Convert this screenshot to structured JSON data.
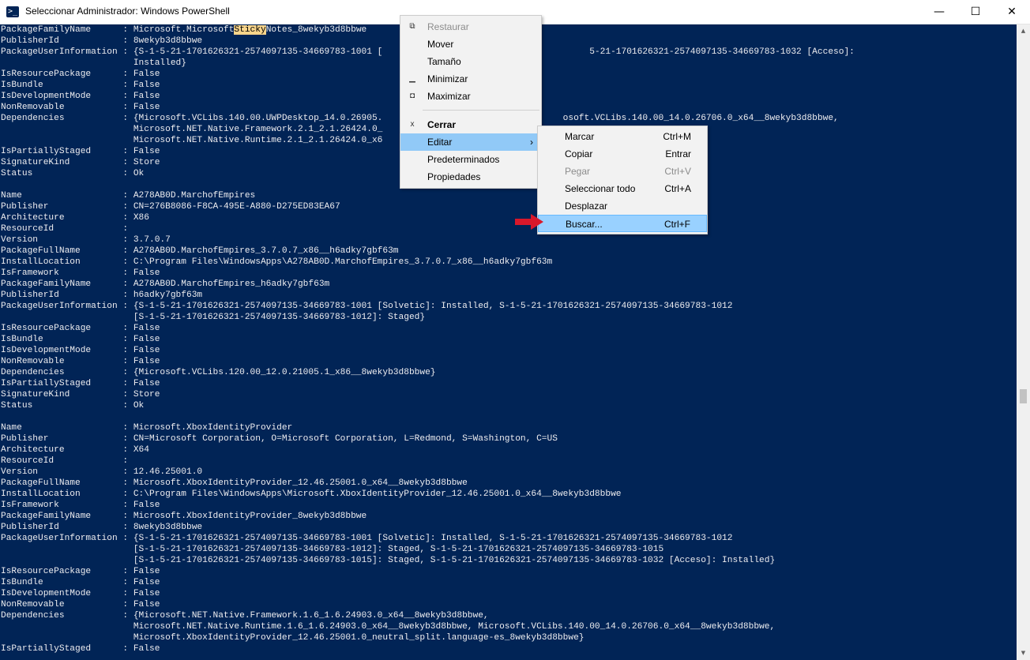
{
  "window": {
    "title": "Seleccionar Administrador: Windows PowerShell",
    "icon": "powershell-icon",
    "controls": {
      "minimize": "—",
      "maximize": "☐",
      "close": "✕"
    }
  },
  "colors": {
    "console_bg": "#012456",
    "console_text": "#eeedf0",
    "highlight": "#f9d58b",
    "menu_bg": "#f2f2f2",
    "menu_active": "#91c9f7",
    "arrow": "#d9182a"
  },
  "search_highlight": "Sticky",
  "console_lines": [
    [
      "PackageFamilyName      : Microsoft.Microsoft",
      "Sticky",
      "Notes_8wekyb3d8bbwe"
    ],
    [
      "PublisherId            : 8wekyb3d8bbwe"
    ],
    [
      "PackageUserInformation : {S-1-5-21-1701626321-2574097135-34669783-1001 [                                       5-21-1701626321-2574097135-34669783-1032 [Acceso]:"
    ],
    [
      "                         Installed}"
    ],
    [
      "IsResourcePackage      : False"
    ],
    [
      "IsBundle               : False"
    ],
    [
      "IsDevelopmentMode      : False"
    ],
    [
      "NonRemovable           : False"
    ],
    [
      "Dependencies           : {Microsoft.VCLibs.140.00.UWPDesktop_14.0.26905.                                  osoft.VCLibs.140.00_14.0.26706.0_x64__8wekyb3d8bbwe,"
    ],
    [
      "                         Microsoft.NET.Native.Framework.2.1_2.1.26424.0_"
    ],
    [
      "                         Microsoft.NET.Native.Runtime.2.1_2.1.26424.0_x6"
    ],
    [
      "IsPartiallyStaged      : False"
    ],
    [
      "SignatureKind          : Store"
    ],
    [
      "Status                 : Ok"
    ],
    [
      ""
    ],
    [
      "Name                   : A278AB0D.MarchofEmpires"
    ],
    [
      "Publisher              : CN=276B8086-F8CA-495E-A880-D275ED83EA67"
    ],
    [
      "Architecture           : X86"
    ],
    [
      "ResourceId             :"
    ],
    [
      "Version                : 3.7.0.7"
    ],
    [
      "PackageFullName        : A278AB0D.MarchofEmpires_3.7.0.7_x86__h6adky7gbf63m"
    ],
    [
      "InstallLocation        : C:\\Program Files\\WindowsApps\\A278AB0D.MarchofEmpires_3.7.0.7_x86__h6adky7gbf63m"
    ],
    [
      "IsFramework            : False"
    ],
    [
      "PackageFamilyName      : A278AB0D.MarchofEmpires_h6adky7gbf63m"
    ],
    [
      "PublisherId            : h6adky7gbf63m"
    ],
    [
      "PackageUserInformation : {S-1-5-21-1701626321-2574097135-34669783-1001 [Solvetic]: Installed, S-1-5-21-1701626321-2574097135-34669783-1012"
    ],
    [
      "                         [S-1-5-21-1701626321-2574097135-34669783-1012]: Staged}"
    ],
    [
      "IsResourcePackage      : False"
    ],
    [
      "IsBundle               : False"
    ],
    [
      "IsDevelopmentMode      : False"
    ],
    [
      "NonRemovable           : False"
    ],
    [
      "Dependencies           : {Microsoft.VCLibs.120.00_12.0.21005.1_x86__8wekyb3d8bbwe}"
    ],
    [
      "IsPartiallyStaged      : False"
    ],
    [
      "SignatureKind          : Store"
    ],
    [
      "Status                 : Ok"
    ],
    [
      ""
    ],
    [
      "Name                   : Microsoft.XboxIdentityProvider"
    ],
    [
      "Publisher              : CN=Microsoft Corporation, O=Microsoft Corporation, L=Redmond, S=Washington, C=US"
    ],
    [
      "Architecture           : X64"
    ],
    [
      "ResourceId             :"
    ],
    [
      "Version                : 12.46.25001.0"
    ],
    [
      "PackageFullName        : Microsoft.XboxIdentityProvider_12.46.25001.0_x64__8wekyb3d8bbwe"
    ],
    [
      "InstallLocation        : C:\\Program Files\\WindowsApps\\Microsoft.XboxIdentityProvider_12.46.25001.0_x64__8wekyb3d8bbwe"
    ],
    [
      "IsFramework            : False"
    ],
    [
      "PackageFamilyName      : Microsoft.XboxIdentityProvider_8wekyb3d8bbwe"
    ],
    [
      "PublisherId            : 8wekyb3d8bbwe"
    ],
    [
      "PackageUserInformation : {S-1-5-21-1701626321-2574097135-34669783-1001 [Solvetic]: Installed, S-1-5-21-1701626321-2574097135-34669783-1012"
    ],
    [
      "                         [S-1-5-21-1701626321-2574097135-34669783-1012]: Staged, S-1-5-21-1701626321-2574097135-34669783-1015"
    ],
    [
      "                         [S-1-5-21-1701626321-2574097135-34669783-1015]: Staged, S-1-5-21-1701626321-2574097135-34669783-1032 [Acceso]: Installed}"
    ],
    [
      "IsResourcePackage      : False"
    ],
    [
      "IsBundle               : False"
    ],
    [
      "IsDevelopmentMode      : False"
    ],
    [
      "NonRemovable           : False"
    ],
    [
      "Dependencies           : {Microsoft.NET.Native.Framework.1.6_1.6.24903.0_x64__8wekyb3d8bbwe,"
    ],
    [
      "                         Microsoft.NET.Native.Runtime.1.6_1.6.24903.0_x64__8wekyb3d8bbwe, Microsoft.VCLibs.140.00_14.0.26706.0_x64__8wekyb3d8bbwe,"
    ],
    [
      "                         Microsoft.XboxIdentityProvider_12.46.25001.0_neutral_split.language-es_8wekyb3d8bbwe}"
    ],
    [
      "IsPartiallyStaged      : False"
    ]
  ],
  "system_menu": {
    "items": [
      {
        "label": "Restaurar",
        "icon": "restore-icon",
        "glyph": "⧉",
        "disabled": true
      },
      {
        "label": "Mover"
      },
      {
        "label": "Tamaño"
      },
      {
        "label": "Minimizar",
        "icon": "minimize-icon",
        "glyph": "▁"
      },
      {
        "label": "Maximizar",
        "icon": "maximize-icon",
        "glyph": "◘"
      },
      {
        "separator": true
      },
      {
        "label": "Cerrar",
        "icon": "close-icon",
        "glyph": "x",
        "bold": true
      },
      {
        "label": "Editar",
        "submenu": true,
        "active": true
      },
      {
        "label": "Predeterminados"
      },
      {
        "label": "Propiedades"
      }
    ]
  },
  "edit_submenu": {
    "items": [
      {
        "label": "Marcar",
        "shortcut": "Ctrl+M"
      },
      {
        "label": "Copiar",
        "shortcut": "Entrar"
      },
      {
        "label": "Pegar",
        "shortcut": "Ctrl+V",
        "disabled": true
      },
      {
        "label": "Seleccionar todo",
        "shortcut": "Ctrl+A"
      },
      {
        "label": "Desplazar",
        "shortcut": ""
      },
      {
        "label": "Buscar...",
        "shortcut": "Ctrl+F",
        "active": true
      }
    ]
  }
}
